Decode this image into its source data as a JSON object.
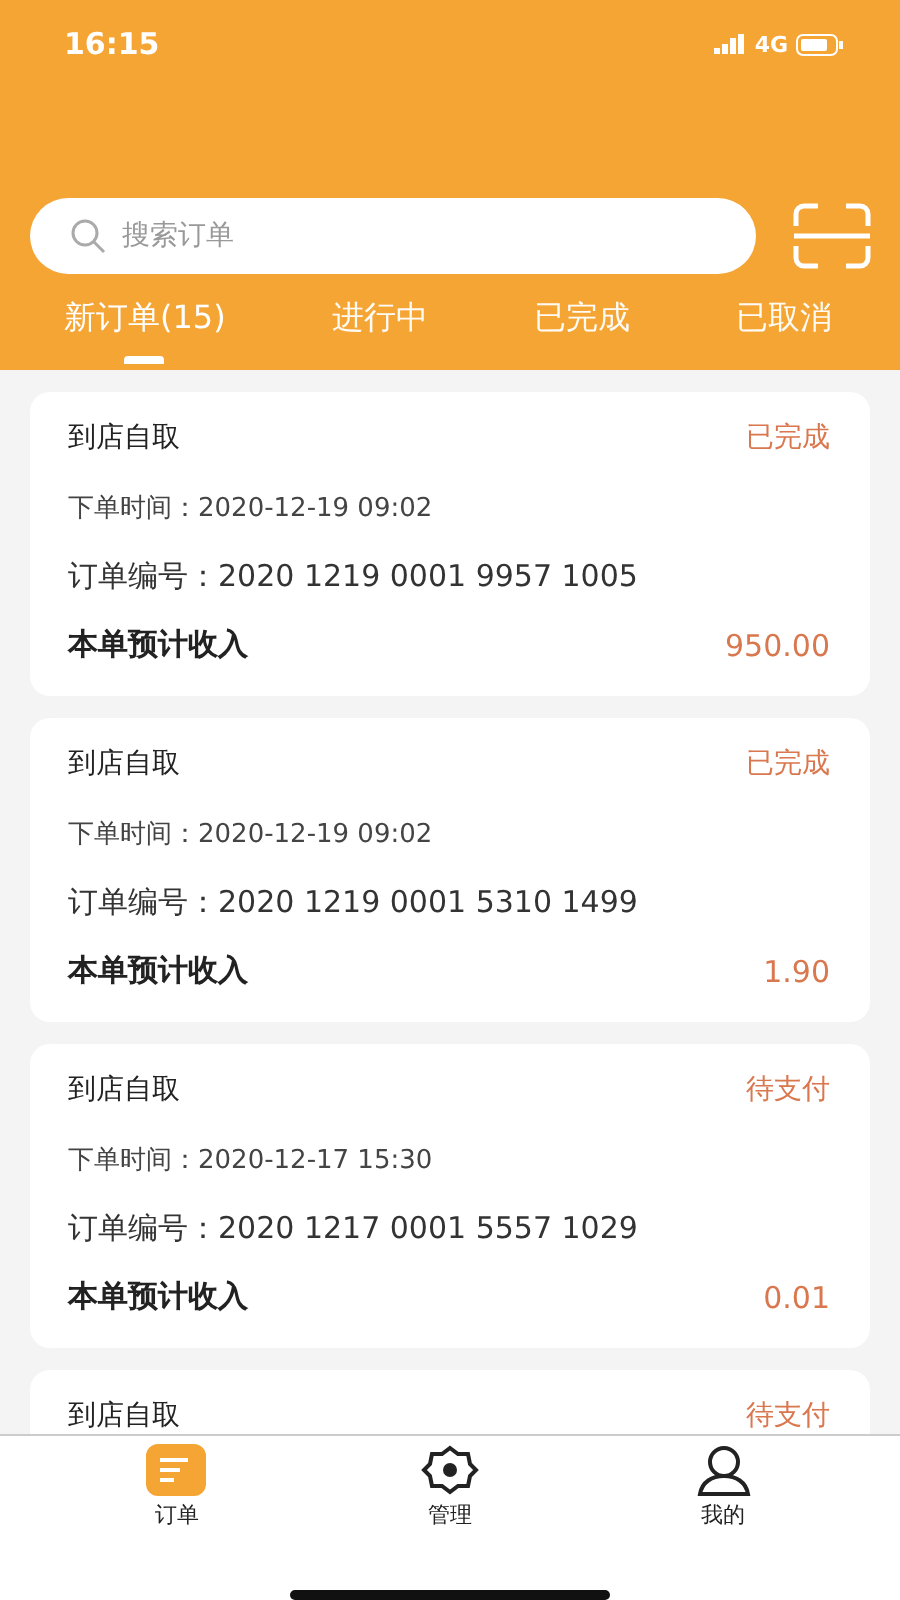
{
  "status_bar": {
    "time": "16:15",
    "network": "4G"
  },
  "search": {
    "placeholder": "搜索订单"
  },
  "tabs": [
    {
      "label": "新订单(15)",
      "selected": true
    },
    {
      "label": "进行中",
      "selected": false
    },
    {
      "label": "已完成",
      "selected": false
    },
    {
      "label": "已取消",
      "selected": false
    }
  ],
  "orders": [
    {
      "type": "到店自取",
      "status": "已完成",
      "time_label": "下单时间：",
      "time": "2020-12-19 09:02",
      "number_label": "订单编号：",
      "number": "2020 1219 0001 9957 1005",
      "income_label": "本单预计收入",
      "income": "950.00"
    },
    {
      "type": "到店自取",
      "status": "已完成",
      "time_label": "下单时间：",
      "time": "2020-12-19 09:02",
      "number_label": "订单编号：",
      "number": "2020 1219 0001 5310 1499",
      "income_label": "本单预计收入",
      "income": "1.90"
    },
    {
      "type": "到店自取",
      "status": "待支付",
      "time_label": "下单时间：",
      "time": "2020-12-17 15:30",
      "number_label": "订单编号：",
      "number": "2020 1217 0001 5557 1029",
      "income_label": "本单预计收入",
      "income": "0.01"
    },
    {
      "type": "到店自取",
      "status": "待支付"
    }
  ],
  "bottom_nav": [
    {
      "label": "订单",
      "kind": "orders",
      "selected": true
    },
    {
      "label": "管理",
      "kind": "manage",
      "selected": false
    },
    {
      "label": "我的",
      "kind": "profile",
      "selected": false
    }
  ]
}
